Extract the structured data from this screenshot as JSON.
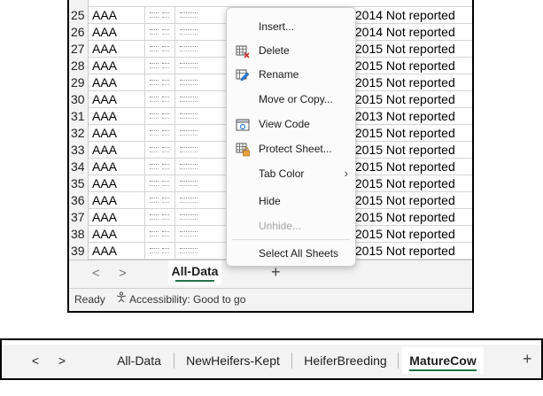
{
  "grid": {
    "rows": [
      {
        "num": "25",
        "col_a": "AAA",
        "status": "/2014 Not reported"
      },
      {
        "num": "26",
        "col_a": "AAA",
        "status": "/2014 Not reported"
      },
      {
        "num": "27",
        "col_a": "AAA",
        "status": "/2015 Not reported"
      },
      {
        "num": "28",
        "col_a": "AAA",
        "status": "/2015 Not reported"
      },
      {
        "num": "29",
        "col_a": "AAA",
        "status": "/2015 Not reported"
      },
      {
        "num": "30",
        "col_a": "AAA",
        "status": "/2015 Not reported"
      },
      {
        "num": "31",
        "col_a": "AAA",
        "status": "/2013 Not reported"
      },
      {
        "num": "32",
        "col_a": "AAA",
        "status": "/2015 Not reported"
      },
      {
        "num": "33",
        "col_a": "AAA",
        "status": "/2015 Not reported"
      },
      {
        "num": "34",
        "col_a": "AAA",
        "status": "/2015 Not reported"
      },
      {
        "num": "35",
        "col_a": "AAA",
        "status": "/2015 Not reported"
      },
      {
        "num": "36",
        "col_a": "AAA",
        "status": "/2015 Not reported"
      },
      {
        "num": "37",
        "col_a": "AAA",
        "status": "/2015 Not reported"
      },
      {
        "num": "38",
        "col_a": "AAA",
        "status": "/2015 Not reported"
      },
      {
        "num": "39",
        "col_a": "AAA",
        "status": "/2015 Not reported"
      }
    ]
  },
  "context_menu": {
    "insert": "Insert...",
    "delete": "Delete",
    "rename": "Rename",
    "move_copy": "Move or Copy...",
    "view_code": "View Code",
    "protect_sheet": "Protect Sheet...",
    "tab_color": "Tab Color",
    "hide": "Hide",
    "unhide": "Unhide...",
    "select_all": "Select All Sheets",
    "icons": {
      "delete": "delete-sheet-icon",
      "rename": "rename-icon",
      "view_code": "view-code-icon",
      "protect": "protect-sheet-icon"
    }
  },
  "top_window": {
    "active_tab": "All-Data",
    "add_sheet": "+",
    "nav_prev": "<",
    "nav_next": ">",
    "status_ready": "Ready",
    "accessibility": "Accessibility: Good to go"
  },
  "bottom_tabs": {
    "nav_prev": "<",
    "nav_next": ">",
    "tabs": [
      "All-Data",
      "NewHeifers-Kept",
      "HeiferBreeding",
      "MatureCow"
    ],
    "active_tab": "MatureCow",
    "add_sheet": "+"
  },
  "colors": {
    "accent": "#217346",
    "disabled_text": "#a6a6a6",
    "status_bar": "#f3f3f3"
  }
}
